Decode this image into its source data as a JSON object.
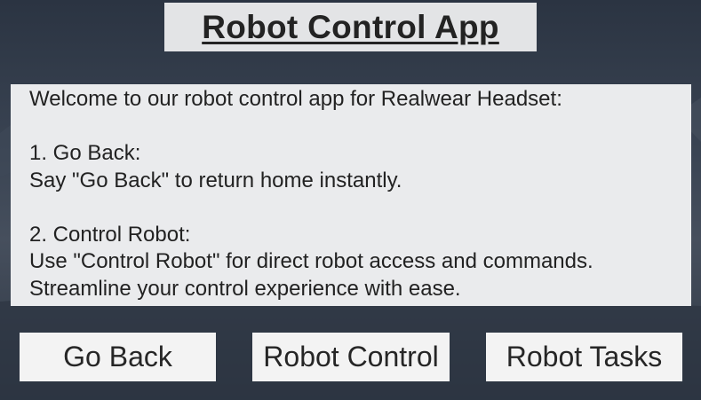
{
  "header": {
    "title": "Robot Control App"
  },
  "info": {
    "lines": [
      "Welcome to our robot control app for Realwear Headset:",
      "",
      "1. Go Back:",
      "Say \"Go Back\" to return home instantly.",
      "",
      "2. Control Robot:",
      "Use \"Control Robot\" for direct robot access and commands.",
      "Streamline your control experience with ease."
    ]
  },
  "buttons": {
    "go_back": "Go Back",
    "robot_control": "Robot Control",
    "robot_tasks": "Robot Tasks"
  },
  "colors": {
    "background": "#3a4453",
    "panel": "#eaebed",
    "button": "#f3f3f3",
    "text": "#222222"
  }
}
